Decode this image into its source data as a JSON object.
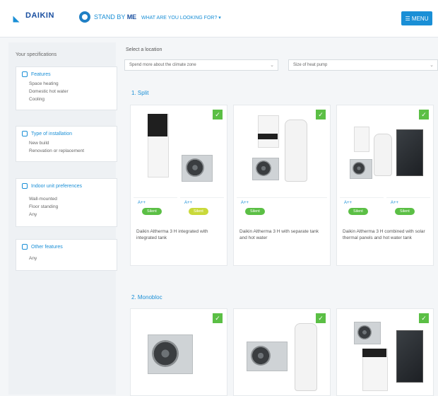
{
  "header": {
    "brand": "DAIKIN",
    "app_name_a": "STAND BY ",
    "app_name_b": "ME",
    "breadcrumb": "WHAT ARE YOU LOOKING FOR? ▾",
    "button": "☰ MENU"
  },
  "sidebar": {
    "title": "Your specifications",
    "groups": [
      {
        "title": "Features",
        "items": [
          "Space heating",
          "Domestic hot water",
          "Cooling"
        ]
      },
      {
        "title": "Type of installation",
        "items": [
          "New build",
          "Renovation or replacement"
        ]
      },
      {
        "title": "Indoor unit preferences",
        "items": [
          "Wall-mounted",
          "Floor standing",
          "Any"
        ]
      },
      {
        "title": "Other features",
        "items": [
          "Any"
        ]
      }
    ]
  },
  "main": {
    "label": "Select a location",
    "select_1": "Spend more about the climate zone",
    "select_2": "Size of heat pump",
    "sections": [
      {
        "title": "1. Split"
      },
      {
        "title": "2. Monobloc"
      }
    ],
    "cards": [
      {
        "specs": [
          {
            "label": "A++",
            "rating": "Silent"
          },
          {
            "label": "A++",
            "rating": "Silent"
          }
        ],
        "description": "Daikin Altherma 3 H integrated with integrated tank"
      },
      {
        "specs": [
          {
            "label": "A++",
            "rating": "Silent"
          }
        ],
        "description": "Daikin Altherma 3 H with separate tank and hot water"
      },
      {
        "specs": [
          {
            "label": "A++",
            "rating": "Silent"
          },
          {
            "label": "A++",
            "rating": "Silent"
          }
        ],
        "description": "Daikin Altherma 3 H combined with solar thermal panels and hot water tank"
      }
    ],
    "check_glyph": "✓"
  },
  "colors": {
    "accent": "#1a8fd6",
    "check": "#5bbf45",
    "sidebar_bg": "#eef1f4"
  }
}
